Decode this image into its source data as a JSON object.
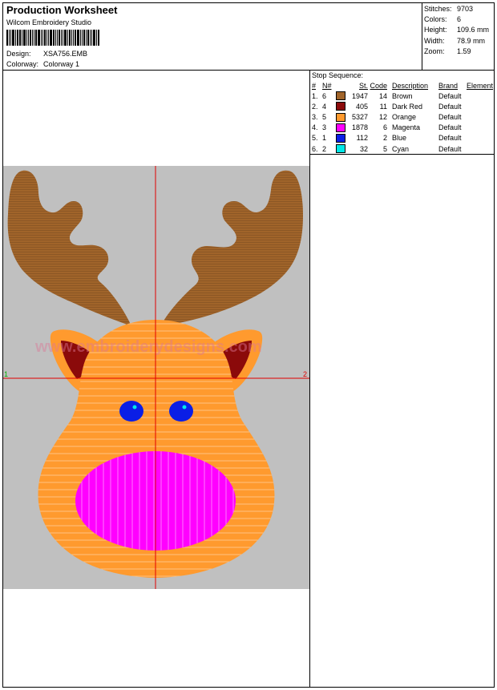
{
  "header": {
    "title": "Production Worksheet",
    "subtitle": "Wilcom Embroidery Studio",
    "design_label": "Design:",
    "design_value": "XSA756.EMB",
    "colorway_label": "Colorway:",
    "colorway_value": "Colorway 1"
  },
  "stats": [
    {
      "label": "Stitches:",
      "value": "9703"
    },
    {
      "label": "Colors:",
      "value": "6"
    },
    {
      "label": "Height:",
      "value": "109.6 mm"
    },
    {
      "label": "Width:",
      "value": "78.9 mm"
    },
    {
      "label": "Zoom:",
      "value": "1.59"
    }
  ],
  "stop_sequence": {
    "title": "Stop Sequence:",
    "headers": {
      "num": "#",
      "n": "N#",
      "st": "St.",
      "code": "Code",
      "desc": "Description",
      "brand": "Brand",
      "element": "Element"
    },
    "rows": [
      {
        "num": "1.",
        "n": "6",
        "color": "#a0642a",
        "st": "1947",
        "code": "14",
        "desc": "Brown",
        "brand": "Default"
      },
      {
        "num": "2.",
        "n": "4",
        "color": "#8b0a0a",
        "st": "405",
        "code": "11",
        "desc": "Dark Red",
        "brand": "Default"
      },
      {
        "num": "3.",
        "n": "5",
        "color": "#ff9a2e",
        "st": "5327",
        "code": "12",
        "desc": "Orange",
        "brand": "Default"
      },
      {
        "num": "4.",
        "n": "3",
        "color": "#ff00ff",
        "st": "1878",
        "code": "6",
        "desc": "Magenta",
        "brand": "Default"
      },
      {
        "num": "5.",
        "n": "1",
        "color": "#0a1ee6",
        "st": "112",
        "code": "2",
        "desc": "Blue",
        "brand": "Default"
      },
      {
        "num": "6.",
        "n": "2",
        "color": "#00e8e8",
        "st": "32",
        "code": "5",
        "desc": "Cyan",
        "brand": "Default"
      }
    ]
  },
  "design": {
    "watermark": "www.embroiderydesigns.com",
    "axis_left_label": "1",
    "axis_right_label": "2",
    "colors": {
      "background": "#c0c0c0",
      "antler": "#a0642a",
      "face": "#ff9a2e",
      "inner_ear": "#8b0a0a",
      "nose": "#ff00ff",
      "eye": "#0a1ee6",
      "eye_highlight": "#00e8e8",
      "crosshair": "#e00000",
      "axis_left": "#00b000"
    }
  }
}
